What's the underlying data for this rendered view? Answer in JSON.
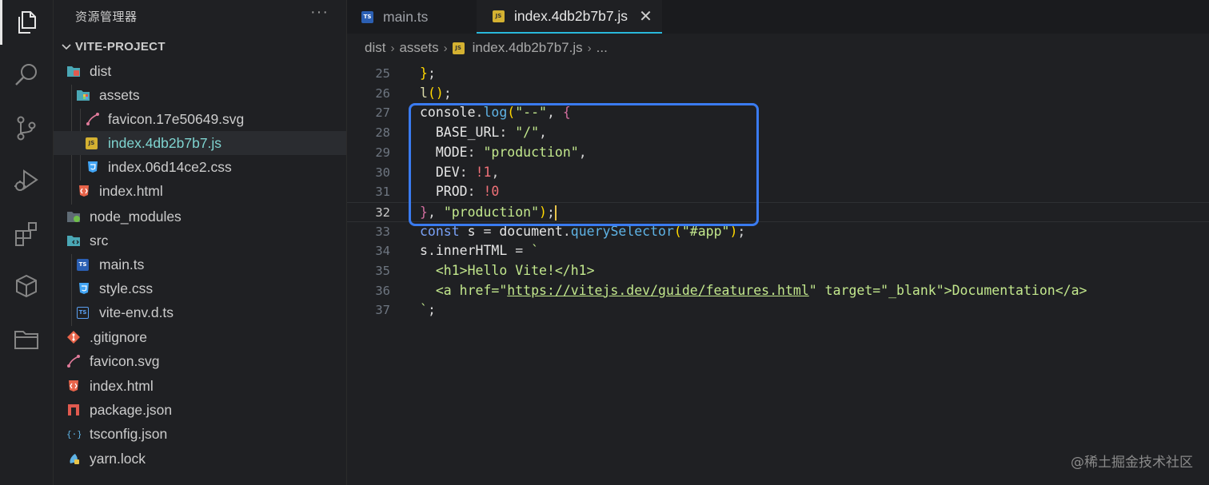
{
  "sidebar": {
    "title": "资源管理器",
    "more": "···",
    "project": "VITE-PROJECT",
    "tree": [
      {
        "label": "dist",
        "icon": "folder-dist-icon"
      },
      {
        "label": "assets",
        "icon": "folder-assets-icon"
      },
      {
        "label": "favicon.17e50649.svg",
        "icon": "svg-file-icon"
      },
      {
        "label": "index.4db2b7b7.js",
        "icon": "js-file-icon"
      },
      {
        "label": "index.06d14ce2.css",
        "icon": "css-file-icon"
      },
      {
        "label": "index.html",
        "icon": "html-file-icon"
      },
      {
        "label": "node_modules",
        "icon": "folder-node-icon"
      },
      {
        "label": "src",
        "icon": "folder-src-icon"
      },
      {
        "label": "main.ts",
        "icon": "ts-file-icon"
      },
      {
        "label": "style.css",
        "icon": "css-file-icon"
      },
      {
        "label": "vite-env.d.ts",
        "icon": "ts-file-icon"
      },
      {
        "label": ".gitignore",
        "icon": "git-file-icon"
      },
      {
        "label": "favicon.svg",
        "icon": "svg-file-icon"
      },
      {
        "label": "index.html",
        "icon": "html-file-icon"
      },
      {
        "label": "package.json",
        "icon": "npm-file-icon"
      },
      {
        "label": "tsconfig.json",
        "icon": "json-file-icon"
      },
      {
        "label": "yarn.lock",
        "icon": "yarn-file-icon"
      }
    ]
  },
  "tabs": [
    {
      "label": "main.ts",
      "badge": "TS"
    },
    {
      "label": "index.4db2b7b7.js",
      "badge": "JS",
      "close": "✕"
    }
  ],
  "breadcrumb": {
    "parts": [
      "dist",
      "assets",
      "index.4db2b7b7.js",
      "..."
    ]
  },
  "code": {
    "line_numbers": [
      "25",
      "26",
      "27",
      "28",
      "29",
      "30",
      "31",
      "32",
      "33",
      "34",
      "35",
      "36",
      "37"
    ],
    "current_line": "32"
  },
  "watermark": "@稀土掘金技术社区",
  "colors": {
    "highlight_box": "#3a7bf0",
    "tab_active_border": "#29b8db",
    "background": "#1f2023"
  }
}
